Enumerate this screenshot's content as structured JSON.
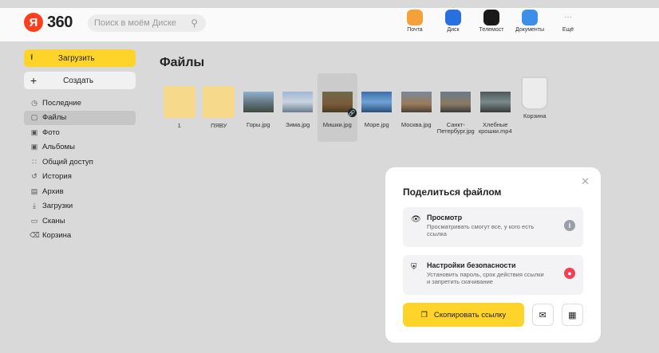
{
  "header": {
    "logo_letter": "Я",
    "logo_text": "360",
    "search_placeholder": "Поиск в моём Диске",
    "apps": [
      {
        "label": "Почта",
        "icon": "mail-icon",
        "color": "#f5a13a"
      },
      {
        "label": "Диск",
        "icon": "disk-icon",
        "color": "#2a6fe0"
      },
      {
        "label": "Телемост",
        "icon": "telemost-icon",
        "color": "#1a1a1a"
      },
      {
        "label": "Документы",
        "icon": "documents-icon",
        "color": "#3b8fe8"
      },
      {
        "label": "Ещё",
        "icon": "more-icon",
        "color": "#999999"
      }
    ]
  },
  "sidebar": {
    "upload_label": "Загрузить",
    "create_label": "Создать",
    "items": [
      {
        "label": "Последние",
        "icon": "clock-icon"
      },
      {
        "label": "Файлы",
        "icon": "file-icon"
      },
      {
        "label": "Фото",
        "icon": "photo-icon"
      },
      {
        "label": "Альбомы",
        "icon": "album-icon"
      },
      {
        "label": "Общий доступ",
        "icon": "shared-icon"
      },
      {
        "label": "История",
        "icon": "history-icon"
      },
      {
        "label": "Архив",
        "icon": "archive-icon"
      },
      {
        "label": "Загрузки",
        "icon": "download-icon"
      },
      {
        "label": "Сканы",
        "icon": "scan-icon"
      },
      {
        "label": "Корзина",
        "icon": "trash-icon"
      }
    ]
  },
  "main": {
    "title": "Файлы",
    "files": [
      {
        "name": "1",
        "type": "folder"
      },
      {
        "name": "ПЯВУ",
        "type": "folder"
      },
      {
        "name": "Горы.jpg",
        "type": "image"
      },
      {
        "name": "Зима.jpg",
        "type": "image"
      },
      {
        "name": "Мишки.jpg",
        "type": "image"
      },
      {
        "name": "Море.jpg",
        "type": "image"
      },
      {
        "name": "Москва.jpg",
        "type": "image"
      },
      {
        "name": "Санкт-Петербург.jpg",
        "type": "image"
      },
      {
        "name": "Хлебные крошки.mp4",
        "type": "video"
      },
      {
        "name": "Корзина",
        "type": "trash"
      }
    ]
  },
  "dialog": {
    "title": "Поделиться файлом",
    "view_title": "Просмотр",
    "view_desc": "Просматривать смогут все, у кого есть ссылка",
    "security_title": "Настройки безопасности",
    "security_desc": "Установить пароль, срок действия ссылки и запретить скачивание",
    "copy_label": "Скопировать ссылку",
    "accent": "#fed42b",
    "alert_color": "#f33f4f"
  }
}
